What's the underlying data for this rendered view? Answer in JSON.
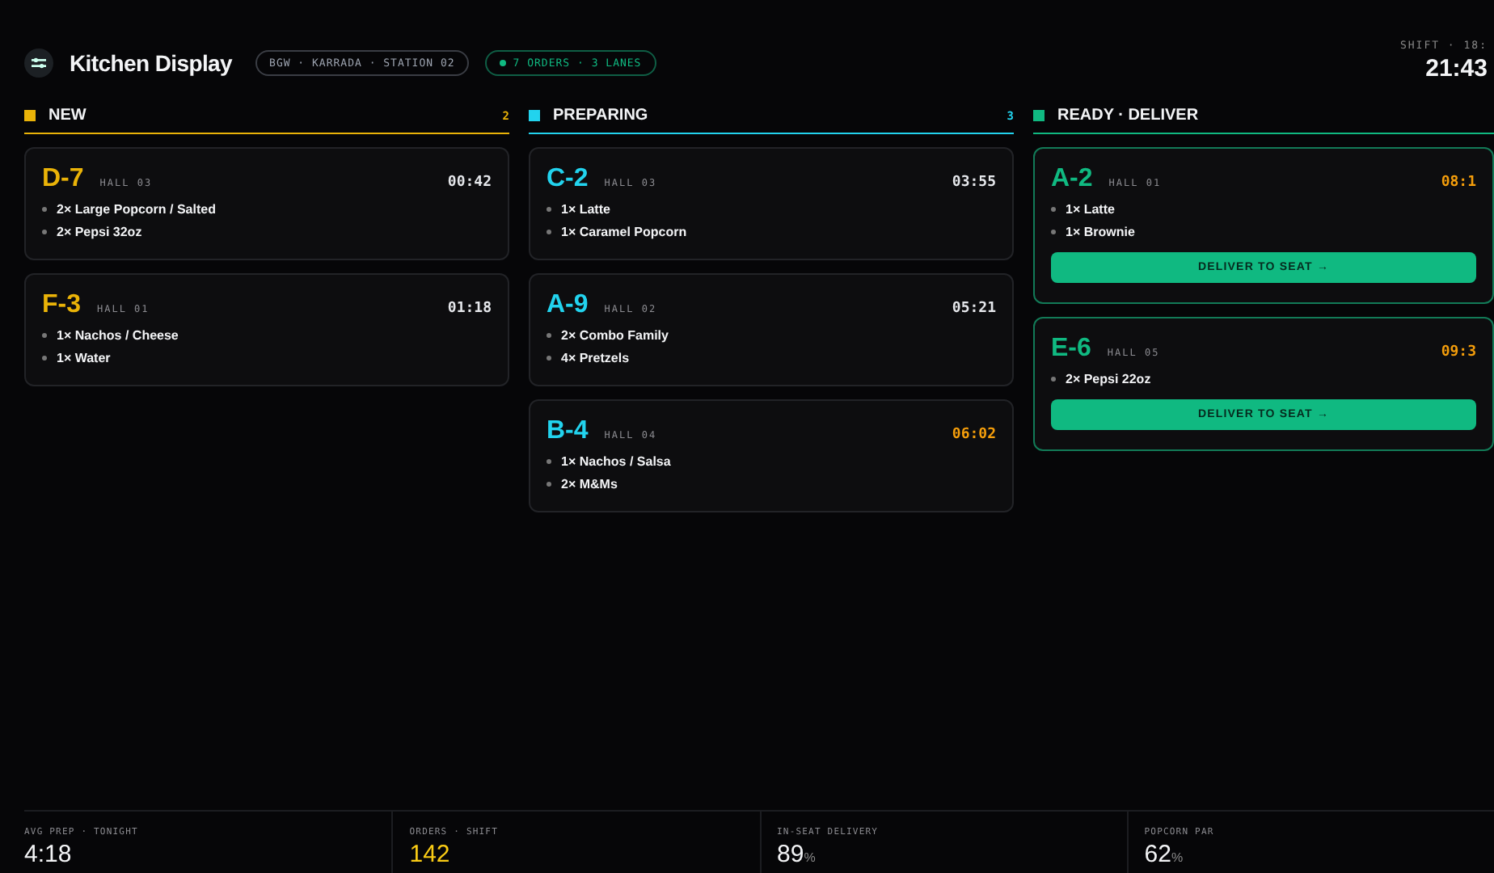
{
  "header": {
    "title": "Kitchen Display",
    "location_chip": "BGW · KARRADA · STATION 02",
    "status_chip": "7 ORDERS · 3 LANES",
    "shift_label": "SHIFT · 18:",
    "clock": "21:43"
  },
  "columns": [
    {
      "title": "NEW",
      "count": "2",
      "color": "#eab308",
      "tickets": [
        {
          "id": "D-7",
          "hall": "HALL 03",
          "time": "00:42",
          "late": false,
          "ready": false,
          "items": [
            "2× Large Popcorn / Salted",
            "2× Pepsi 32oz"
          ]
        },
        {
          "id": "F-3",
          "hall": "HALL 01",
          "time": "01:18",
          "late": false,
          "ready": false,
          "items": [
            "1× Nachos / Cheese",
            "1× Water"
          ]
        }
      ]
    },
    {
      "title": "PREPARING",
      "count": "3",
      "color": "#22d3ee",
      "tickets": [
        {
          "id": "C-2",
          "hall": "HALL 03",
          "time": "03:55",
          "late": false,
          "ready": false,
          "items": [
            "1× Latte",
            "1× Caramel Popcorn"
          ]
        },
        {
          "id": "A-9",
          "hall": "HALL 02",
          "time": "05:21",
          "late": false,
          "ready": false,
          "items": [
            "2× Combo Family",
            "4× Pretzels"
          ]
        },
        {
          "id": "B-4",
          "hall": "HALL 04",
          "time": "06:02",
          "late": true,
          "ready": false,
          "items": [
            "1× Nachos / Salsa",
            "2× M&Ms"
          ]
        }
      ]
    },
    {
      "title": "READY · DELIVER",
      "color": "#10b981",
      "tickets": [
        {
          "id": "A-2",
          "hall": "HALL 01",
          "time": "08:1",
          "late": true,
          "ready": true,
          "action": "DELIVER TO SEAT →",
          "items": [
            "1× Latte",
            "1× Brownie"
          ]
        },
        {
          "id": "E-6",
          "hall": "HALL 05",
          "time": "09:3",
          "late": true,
          "ready": true,
          "action": "DELIVER TO SEAT →",
          "items": [
            "2× Pepsi 22oz"
          ]
        }
      ]
    }
  ],
  "stats": [
    {
      "label": "AVG PREP · TONIGHT",
      "value": "4:18",
      "highlight": false
    },
    {
      "label": "ORDERS · SHIFT",
      "value": "142",
      "highlight": true
    },
    {
      "label": "IN-SEAT DELIVERY",
      "value": "89",
      "unit": "%",
      "highlight": false
    },
    {
      "label": "POPCORN PAR",
      "value": "62",
      "unit": "%",
      "highlight": false
    }
  ]
}
